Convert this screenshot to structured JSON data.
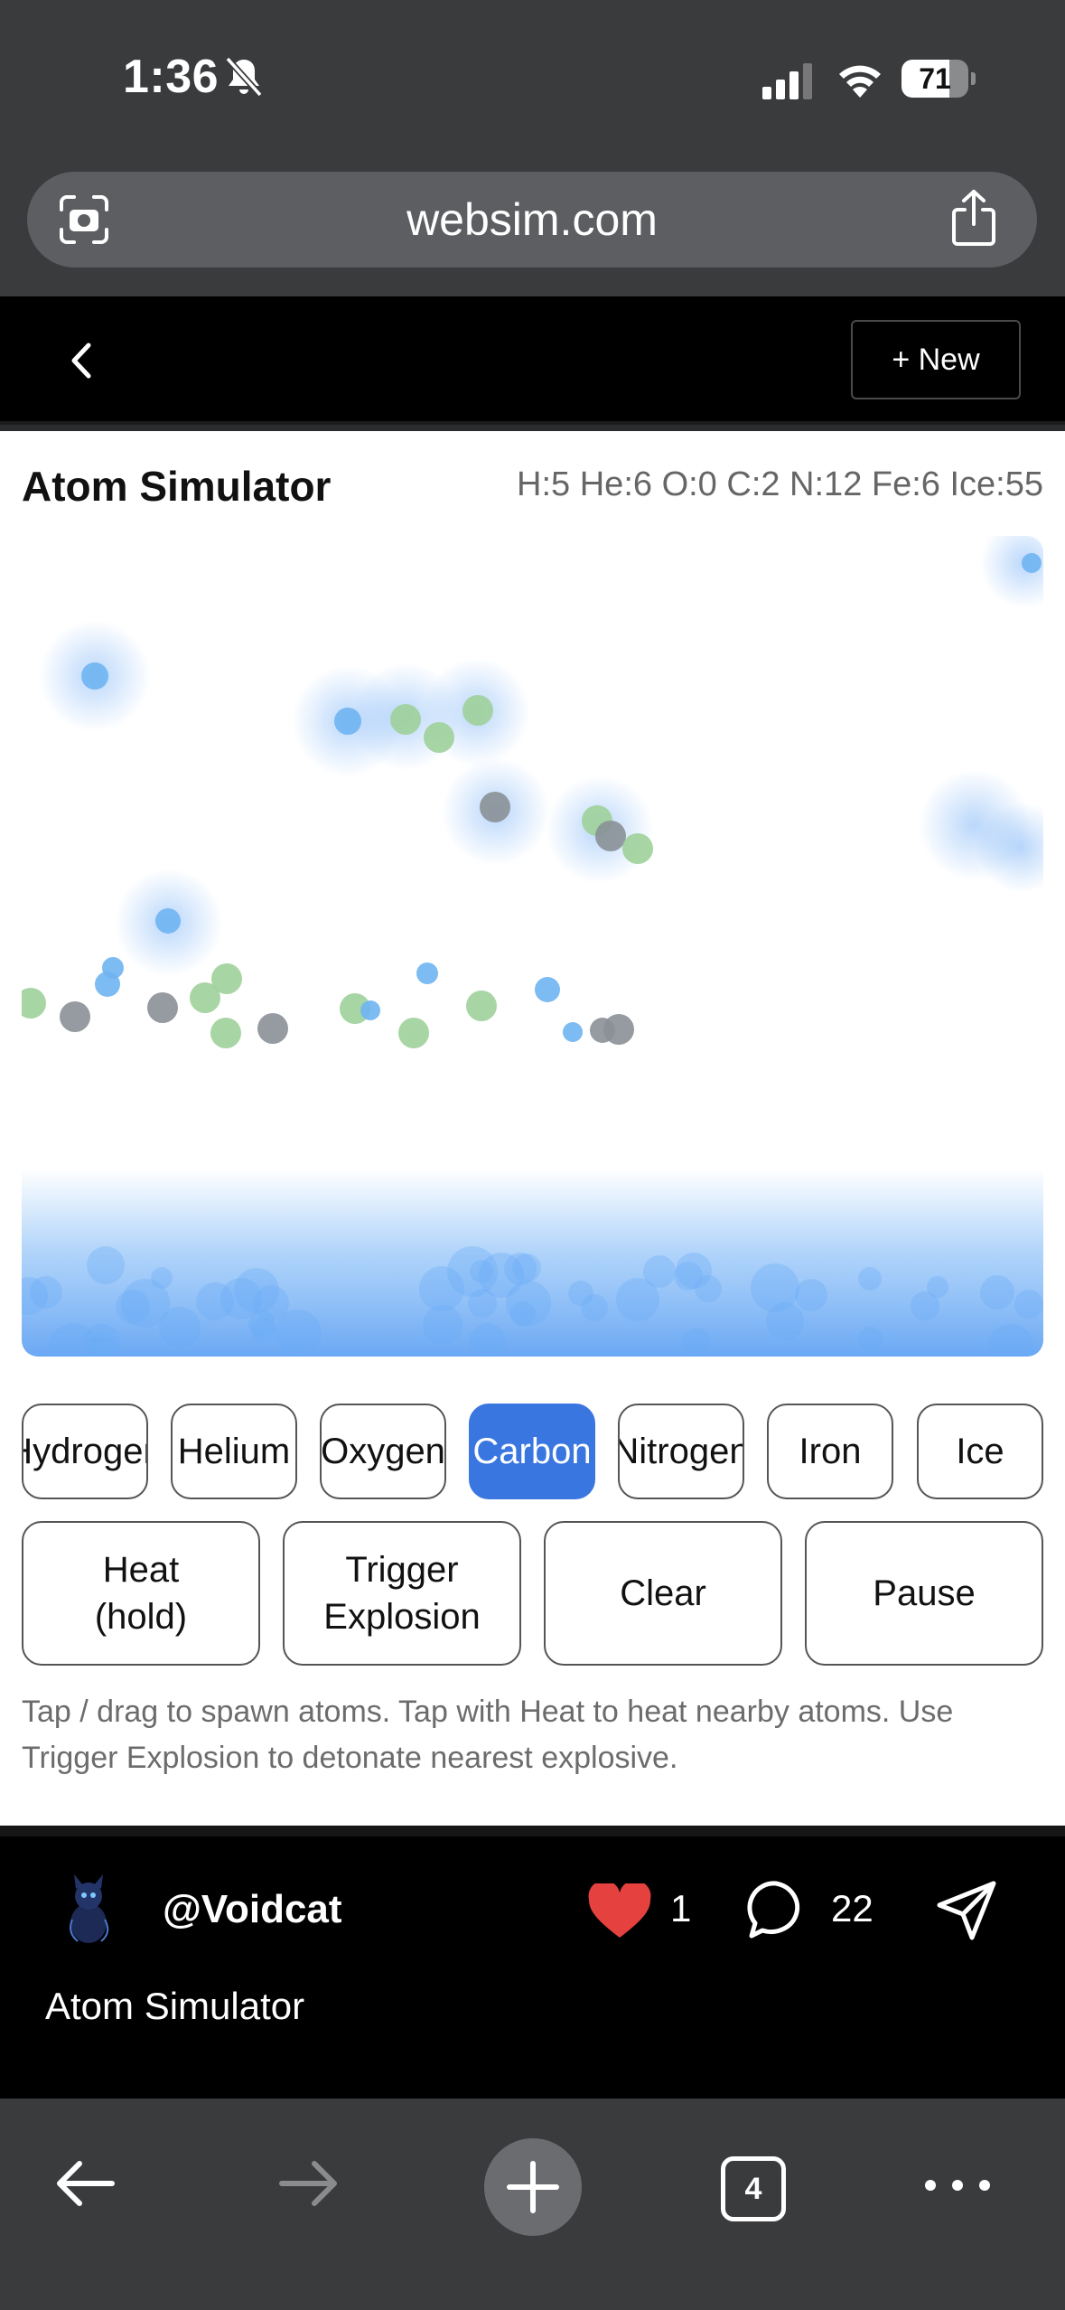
{
  "status_bar": {
    "time": "1:36",
    "battery_percent": "71",
    "battery_level": 0.71
  },
  "url_bar": {
    "url": "websim.com"
  },
  "header": {
    "new_label": "+ New"
  },
  "app": {
    "title": "Atom Simulator",
    "counts": "H:5 He:6 O:0 C:2 N:12 Fe:6 Ice:55",
    "elements": [
      "Hydrogen",
      "Helium",
      "Oxygen",
      "Carbon",
      "Nitrogen",
      "Iron",
      "Ice"
    ],
    "selected_element": "Carbon",
    "actions": [
      {
        "line1": "Heat",
        "line2": "(hold)"
      },
      {
        "line1": "Trigger",
        "line2": "Explosion"
      },
      {
        "line1": "Clear",
        "line2": ""
      },
      {
        "line1": "Pause",
        "line2": ""
      }
    ],
    "help_text": "Tap / drag to spawn atoms. Tap with Heat to heat nearby atoms. Use Trigger Explosion to detonate nearest explosive.",
    "atom_colors": {
      "ice": "#6fb4f2",
      "nitrogen": "#9fd09a",
      "iron": "#8a9096",
      "glow": "#5aa0f5"
    }
  },
  "social": {
    "username": "@Voidcat",
    "likes": "1",
    "comments": "22",
    "post_title": "Atom Simulator",
    "heart_color": "#e5423f"
  },
  "toolbar": {
    "tab_count": "4"
  }
}
